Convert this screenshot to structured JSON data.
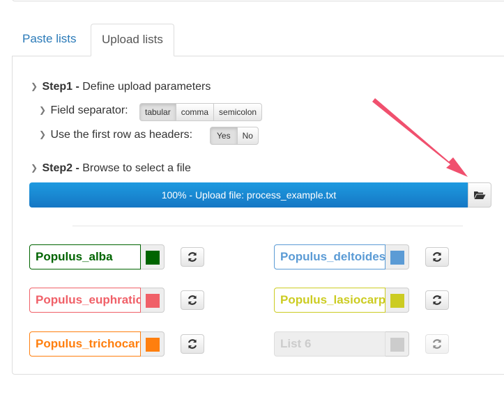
{
  "tabs": [
    {
      "label": "Paste lists",
      "active": false
    },
    {
      "label": "Upload lists",
      "active": true
    }
  ],
  "step1": {
    "num": "Step1 -",
    "text": "Define upload parameters",
    "separator_label": "Field separator:",
    "separator_options": [
      "tabular",
      "comma",
      "semicolon"
    ],
    "separator_selected": "tabular",
    "headers_label": "Use the first row as headers:",
    "headers_options": [
      "Yes",
      "No"
    ],
    "headers_selected": "Yes"
  },
  "step2": {
    "num": "Step2 -",
    "text": "Browse to select a file",
    "progress_text": "100% - Upload file: process_example.txt",
    "progress_percent": 100
  },
  "lists": [
    {
      "name": "Populus_alba",
      "color": "#006400",
      "disabled": false
    },
    {
      "name": "Populus_deltoides",
      "color": "#5b9bd5",
      "disabled": false
    },
    {
      "name": "Populus_euphratica",
      "color": "#f06068",
      "disabled": false
    },
    {
      "name": "Populus_lasiocarpa",
      "color": "#cccc22",
      "disabled": false
    },
    {
      "name": "Populus_trichocarpa",
      "color": "#ff7f0e",
      "disabled": false
    },
    {
      "name": "List 6",
      "color": "#cccccc",
      "disabled": true
    }
  ],
  "icons": {
    "folder": "folder-open-icon",
    "refresh": "refresh-icon",
    "chevron": "chevron-right-icon"
  },
  "colors": {
    "accent": "#2a7ab8",
    "progress": "#1a88d2",
    "annotation_arrow": "#f0506e"
  }
}
